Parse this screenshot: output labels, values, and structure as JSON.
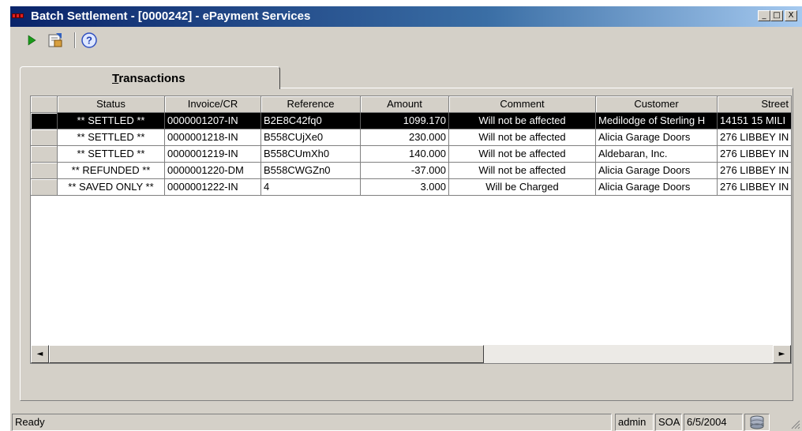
{
  "window": {
    "title": "Batch Settlement - [0000242] - ePayment Services",
    "minimize": "_",
    "maximize": "□",
    "close": "X"
  },
  "toolbar": {
    "icons": [
      "play-icon",
      "import-icon",
      "help-icon"
    ]
  },
  "tabs": [
    {
      "label": "Transactions"
    }
  ],
  "grid": {
    "columns": [
      "Status",
      "Invoice/CR",
      "Reference",
      "Amount",
      "Comment",
      "Customer",
      "Street"
    ],
    "rows": [
      {
        "status": "** SETTLED **",
        "invoice": "0000001207-IN",
        "reference": "B2E8C42fq0",
        "amount": "1099.170",
        "comment": "Will not be affected",
        "customer": "Medilodge of Sterling H",
        "street": "14151 15 MILI"
      },
      {
        "status": "** SETTLED **",
        "invoice": "0000001218-IN",
        "reference": "B558CUjXe0",
        "amount": "230.000",
        "comment": "Will not be affected",
        "customer": "Alicia Garage Doors",
        "street": "276 LIBBEY IN"
      },
      {
        "status": "** SETTLED **",
        "invoice": "0000001219-IN",
        "reference": "B558CUmXh0",
        "amount": "140.000",
        "comment": "Will not be affected",
        "customer": "Aldebaran, Inc.",
        "street": "276 LIBBEY IN"
      },
      {
        "status": "** REFUNDED **",
        "invoice": "0000001220-DM",
        "reference": "B558CWGZn0",
        "amount": "-37.000",
        "comment": "Will not be affected",
        "customer": "Alicia Garage Doors",
        "street": "276 LIBBEY IN"
      },
      {
        "status": "** SAVED ONLY **",
        "invoice": "0000001222-IN",
        "reference": "4",
        "amount": "3.000",
        "comment": "Will be Charged",
        "customer": "Alicia Garage Doors",
        "street": "276 LIBBEY IN"
      }
    ],
    "selected_row": 0,
    "scroll_left": "◄",
    "scroll_right": "►"
  },
  "status_bar": {
    "message": "Ready",
    "user": "admin",
    "company": "SOA",
    "date": "6/5/2004"
  }
}
